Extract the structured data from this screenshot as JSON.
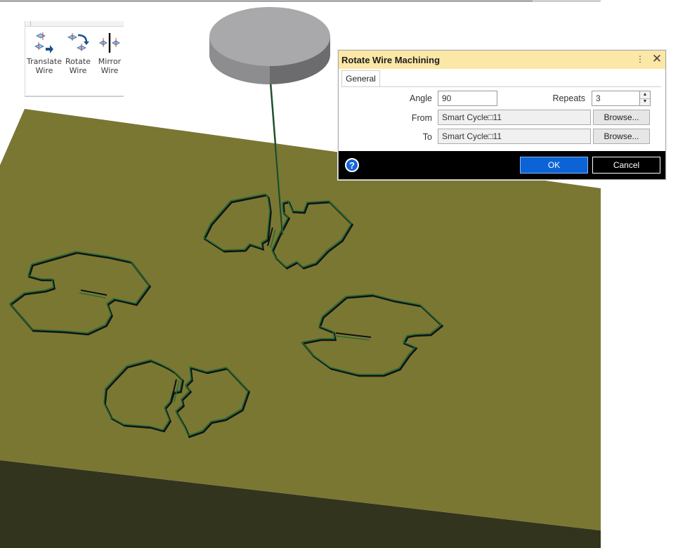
{
  "ribbon": {
    "buttons": [
      {
        "line1": "Translate",
        "line2": "Wire",
        "icon": "translate-wire-icon"
      },
      {
        "line1": "Rotate",
        "line2": "Wire",
        "icon": "rotate-wire-icon"
      },
      {
        "line1": "Mirror",
        "line2": "Wire",
        "icon": "mirror-wire-icon"
      }
    ]
  },
  "dialog": {
    "title": "Rotate Wire Machining",
    "more_icon": "⋮",
    "close_icon": "✕",
    "tabs": [
      "General"
    ],
    "angle_label": "Angle",
    "angle_value": "90",
    "repeats_label": "Repeats",
    "repeats_value": "3",
    "from_label": "From",
    "from_value": "Smart Cycle□11",
    "to_label": "To",
    "to_value": "Smart Cycle□11",
    "browse_label": "Browse...",
    "help_icon": "?",
    "ok_label": "OK",
    "cancel_label": "Cancel"
  },
  "colors": {
    "plate_top": "#7a7733",
    "plate_side": "#33341e",
    "wire_path": "#1f6a35",
    "cut_edge": "#111111",
    "tool_head": "#a9a9ab",
    "dialog_title_bg": "#fbe7a6",
    "ok_button": "#0b63d6"
  }
}
